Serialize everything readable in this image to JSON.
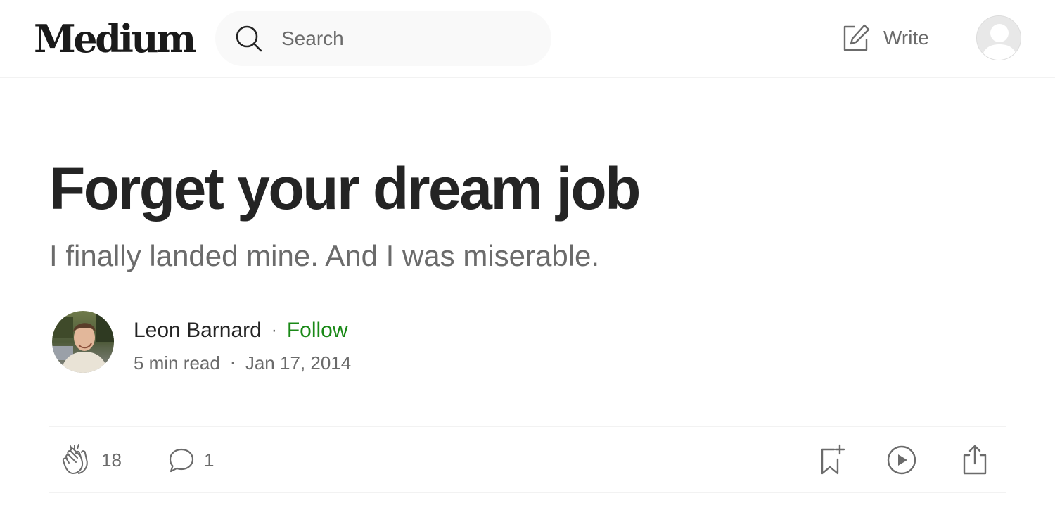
{
  "header": {
    "logo": "Medium",
    "search": {
      "placeholder": "Search",
      "value": ""
    },
    "write_label": "Write"
  },
  "article": {
    "title": "Forget your dream job",
    "subtitle": "I finally landed mine. And I was miserable.",
    "author": {
      "name": "Leon Barnard",
      "follow_label": "Follow"
    },
    "read_time": "5 min read",
    "date": "Jan 17, 2014"
  },
  "actions": {
    "claps": "18",
    "comments": "1"
  },
  "colors": {
    "follow": "#1a8917",
    "text_primary": "#242424",
    "text_secondary": "#6b6b6b",
    "divider": "#f2f2f2"
  },
  "icons": {
    "search": "search-icon",
    "write": "write-icon",
    "user": "user-avatar",
    "clap": "clap-icon",
    "comment": "comment-icon",
    "save": "bookmark-add-icon",
    "listen": "play-circle-icon",
    "share": "share-icon"
  }
}
